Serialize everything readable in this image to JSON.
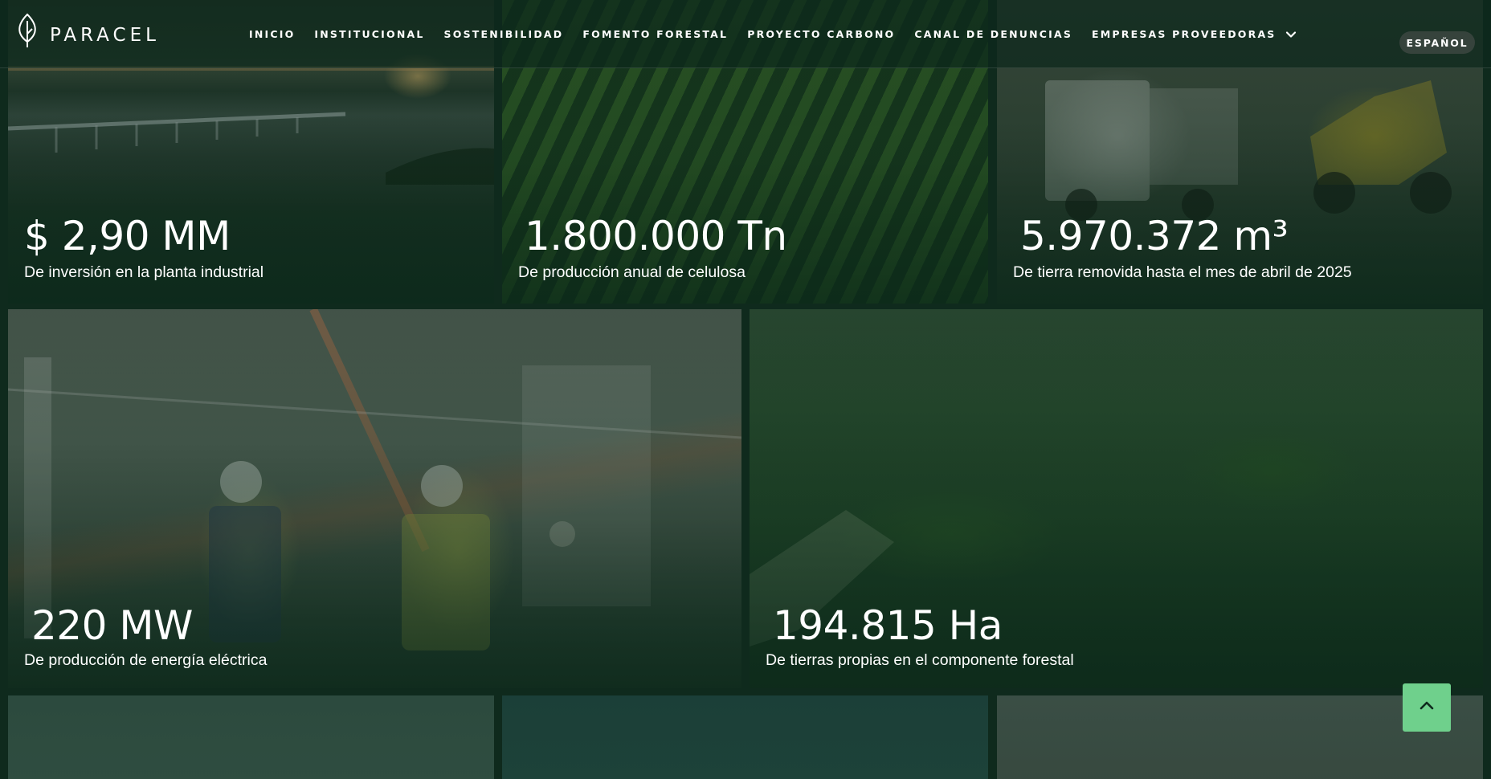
{
  "brand": {
    "name": "PARACEL",
    "logo_icon": "leaf-icon"
  },
  "nav": {
    "items": [
      {
        "label": "INICIO"
      },
      {
        "label": "INSTITUCIONAL"
      },
      {
        "label": "SOSTENIBILIDAD"
      },
      {
        "label": "FOMENTO FORESTAL"
      },
      {
        "label": "PROYECTO CARBONO"
      },
      {
        "label": "CANAL DE DENUNCIAS"
      },
      {
        "label": "EMPRESAS PROVEEDORAS",
        "icon": "chevron-down-icon"
      }
    ],
    "language": "ESPAÑOL"
  },
  "stats": [
    {
      "value": "$ 2,90 MM",
      "caption": "De inversión en la planta industrial"
    },
    {
      "value": "1.800.000 Tn",
      "caption": "De producción anual de celulosa"
    },
    {
      "value": "5.970.372 m³",
      "caption": "De tierra removida hasta el mes de abril de 2025"
    },
    {
      "value": "220 MW",
      "caption": "De producción de energía eléctrica"
    },
    {
      "value": "194.815 Ha",
      "caption": "De tierras propias en el componente forestal"
    }
  ],
  "scroll_top": {
    "icon": "chevron-up-icon"
  },
  "colors": {
    "accent": "#6fd08c",
    "overlay": "#0f2a1d"
  }
}
